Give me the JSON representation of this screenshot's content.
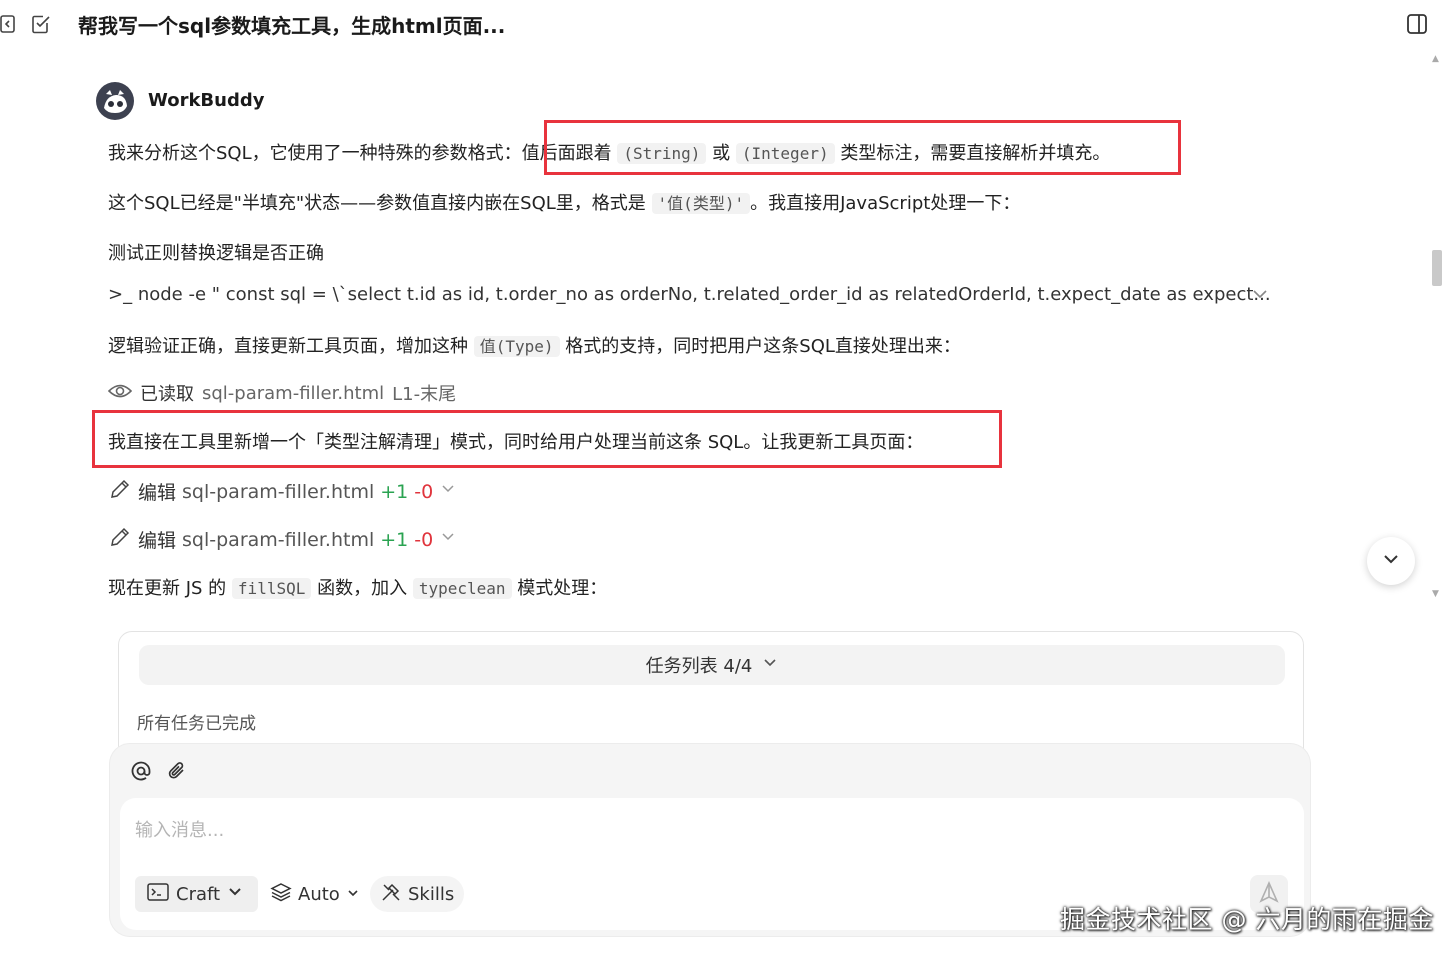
{
  "header": {
    "title": "帮我写一个sql参数填充工具，生成html页面..."
  },
  "message": {
    "bot_name": "WorkBuddy",
    "p1": {
      "before": "我来分析这个SQL，它使用了一种特殊的参数格式：",
      "hl_a": "值后面跟着",
      "code1": "(String)",
      "or": "或",
      "code2": "(Integer)",
      "hl_b": "类型标注，需要直接解析并填充。"
    },
    "p2": {
      "before": "这个SQL已经是\"半填充\"状态——参数值直接内嵌在SQL里，格式是",
      "code": "'值(类型)'",
      "after": "。我直接用JavaScript处理一下："
    },
    "p3": "测试正则替换逻辑是否正确",
    "terminal": {
      "prompt": ">_",
      "command": "node -e \" const sql = \\`select t.id as id, t.order_no as orderNo, t.related_order_id as relatedOrderId, t.expect_date as expect..."
    },
    "p4": {
      "before": "逻辑验证正确，直接更新工具页面，增加这种",
      "code": "值(Type)",
      "after": "格式的支持，同时把用户这条SQL直接处理出来："
    },
    "read": {
      "label": "已读取",
      "file": "sql-param-filler.html",
      "range": "L1-末尾"
    },
    "p5": "我直接在工具里新增一个「类型注解清理」模式，同时给用户处理当前这条 SQL。让我更新工具页面：",
    "edits": [
      {
        "label": "编辑",
        "file": "sql-param-filler.html",
        "added": "+1",
        "removed": "-0"
      },
      {
        "label": "编辑",
        "file": "sql-param-filler.html",
        "added": "+1",
        "removed": "-0"
      }
    ],
    "p6": {
      "before": "现在更新 JS 的",
      "code1": "fillSQL",
      "mid": "函数，加入",
      "code2": "typeclean",
      "after": "模式处理："
    }
  },
  "tasks": {
    "header": "任务列表 4/4",
    "status": "所有任务已完成"
  },
  "composer": {
    "placeholder": "输入消息...",
    "craft_label": "Craft",
    "auto_label": "Auto",
    "skills_label": "Skills"
  },
  "watermark": "掘金技术社区 @ 六月的雨在掘金",
  "colors": {
    "highlight_box": "#e8333d",
    "diff_added": "#2aa351",
    "diff_removed": "#e0343c"
  }
}
